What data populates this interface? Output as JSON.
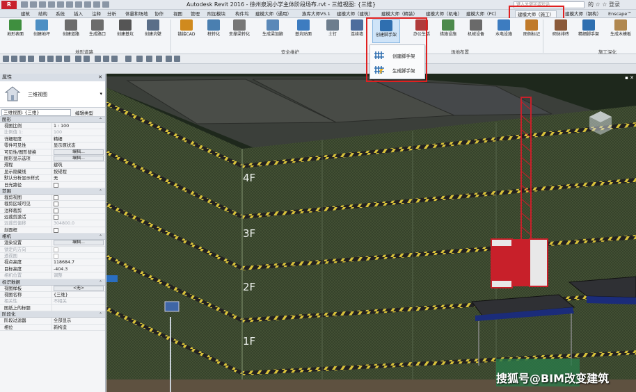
{
  "app": {
    "window_title": "Autodesk Revit 2016 -   徐州泉润小学主体阶段场布.rvt - 三维视图: {三维}",
    "logo": "R",
    "search_placeholder": "键入关键字或短语",
    "title_icons": "的 ☆ ☆ 登录"
  },
  "tabs": [
    {
      "label": "建筑",
      "active": false
    },
    {
      "label": "结构",
      "active": false
    },
    {
      "label": "系统",
      "active": false
    },
    {
      "label": "插入",
      "active": false
    },
    {
      "label": "注释",
      "active": false
    },
    {
      "label": "分析",
      "active": false
    },
    {
      "label": "体量和场地",
      "active": false
    },
    {
      "label": "协作",
      "active": false
    },
    {
      "label": "视图",
      "active": false
    },
    {
      "label": "管理",
      "active": false
    },
    {
      "label": "附加模块",
      "active": false
    },
    {
      "label": "构件坞",
      "active": false
    },
    {
      "label": "建模大师（通用）",
      "active": false
    },
    {
      "label": "族库大师V5.1",
      "active": false
    },
    {
      "label": "建模大师（建筑）",
      "active": false
    },
    {
      "label": "建模大师（精装）",
      "active": false
    },
    {
      "label": "建模大师（机电）",
      "active": false
    },
    {
      "label": "建模大师（PC）",
      "active": false
    },
    {
      "label": "建模大师（施工）",
      "active": true
    },
    {
      "label": "建模大师（钢构）",
      "active": false
    },
    {
      "label": "Enscape™",
      "active": false
    }
  ],
  "ribbon": {
    "buttons": [
      {
        "label": "地形表面",
        "color": "#3f8f3f"
      },
      {
        "label": "创建地坪",
        "color": "#4d8fc4"
      },
      {
        "label": "创建道路",
        "color": "#6c6c6c"
      },
      {
        "label": "生成路口",
        "color": "#6c6c6c"
      },
      {
        "label": "创建基坑",
        "color": "#555555"
      },
      {
        "label": "创建坑壁",
        "color": "#5a6e88"
      },
      {
        "label": "链接CAD",
        "color": "#d08a1e"
      },
      {
        "label": "桩转化",
        "color": "#4a7fb0"
      },
      {
        "label": "支撑梁转化",
        "color": "#777777"
      },
      {
        "label": "生成梁加腋",
        "color": "#5a88b8"
      },
      {
        "label": "基坑贴面",
        "color": "#3d7cc0"
      },
      {
        "label": "土钉",
        "color": "#6d7d8d"
      },
      {
        "label": "连续墙",
        "color": "#4d6d9d"
      },
      {
        "label": "创建脚手架",
        "color": "#2f6fb0"
      },
      {
        "label": "办公生活",
        "color": "#b03b3b"
      },
      {
        "label": "措施设施",
        "color": "#4c8a4c"
      },
      {
        "label": "机械设备",
        "color": "#6a6a6a"
      },
      {
        "label": "水电设施",
        "color": "#3d7cc0"
      },
      {
        "label": "图例标记",
        "color": "#c07a2a"
      },
      {
        "label": "砌体排砖",
        "color": "#8a5a3a"
      },
      {
        "label": "精细脚手架",
        "color": "#2f6fb0"
      },
      {
        "label": "生成木模板",
        "color": "#b08850"
      }
    ],
    "panels": [
      "地形道路",
      "安全维护",
      "场地布置",
      "施工深化"
    ]
  },
  "dropdown": {
    "items": [
      "创建脚手架",
      "生成脚手架"
    ]
  },
  "properties": {
    "header": "属性",
    "close": "✕",
    "type_name": "三维视图",
    "type_selector": "三维视图: {三维}",
    "edit_type": "编辑类型",
    "groups": [
      {
        "name": "图形",
        "rows": [
          {
            "k": "视图比例",
            "v": "1 : 100",
            "kind": "input"
          },
          {
            "k": "比例值 1:",
            "v": "100",
            "kind": "text",
            "disabled": true
          },
          {
            "k": "详细程度",
            "v": "精细",
            "kind": "text"
          },
          {
            "k": "零件可见性",
            "v": "显示原状态",
            "kind": "text"
          },
          {
            "k": "可见性/图形替换",
            "v": "编辑...",
            "kind": "button"
          },
          {
            "k": "图形显示选项",
            "v": "编辑...",
            "kind": "button"
          },
          {
            "k": "规程",
            "v": "建筑",
            "kind": "text"
          },
          {
            "k": "显示隐藏线",
            "v": "按规程",
            "kind": "text"
          },
          {
            "k": "默认分析显示样式",
            "v": "无",
            "kind": "text"
          },
          {
            "k": "日光路径",
            "v": "",
            "kind": "check"
          }
        ]
      },
      {
        "name": "范围",
        "rows": [
          {
            "k": "裁剪视图",
            "v": "",
            "kind": "check"
          },
          {
            "k": "裁剪区域可见",
            "v": "",
            "kind": "check"
          },
          {
            "k": "注释裁剪",
            "v": "",
            "kind": "check"
          },
          {
            "k": "远裁剪激活",
            "v": "",
            "kind": "check"
          },
          {
            "k": "远裁剪偏移",
            "v": "304800.0",
            "kind": "text",
            "disabled": true
          },
          {
            "k": "剖面框",
            "v": "",
            "kind": "check"
          }
        ]
      },
      {
        "name": "相机",
        "rows": [
          {
            "k": "渲染设置",
            "v": "编辑...",
            "kind": "button"
          },
          {
            "k": "锁定的方向",
            "v": "",
            "kind": "check-dis",
            "disabled": true
          },
          {
            "k": "透视图",
            "v": "",
            "kind": "check-dis",
            "disabled": true
          },
          {
            "k": "视点高度",
            "v": "118684.7",
            "kind": "text"
          },
          {
            "k": "目标高度",
            "v": "-404.3",
            "kind": "text"
          },
          {
            "k": "相机位置",
            "v": "调整",
            "kind": "text",
            "disabled": true
          }
        ]
      },
      {
        "name": "标识数据",
        "rows": [
          {
            "k": "视图样板",
            "v": "<无>",
            "kind": "button"
          },
          {
            "k": "视图名称",
            "v": "{三维}",
            "kind": "text"
          },
          {
            "k": "相关性",
            "v": "不相关",
            "kind": "text",
            "disabled": true
          },
          {
            "k": "图纸上的标题",
            "v": "",
            "kind": "text"
          }
        ]
      },
      {
        "name": "阶段化",
        "rows": [
          {
            "k": "阶段过滤器",
            "v": "全部显示",
            "kind": "text"
          },
          {
            "k": "相位",
            "v": "新构造",
            "kind": "text"
          }
        ]
      }
    ]
  },
  "viewport": {
    "close": "▪ ✕",
    "floors": [
      "4F",
      "3F",
      "2F",
      "1F"
    ],
    "watermark": "搜狐号@BIM改变建筑",
    "colors": {
      "net": "#3d4a2e",
      "hoist": "#c8202a",
      "facade": "#5a6a48"
    }
  }
}
